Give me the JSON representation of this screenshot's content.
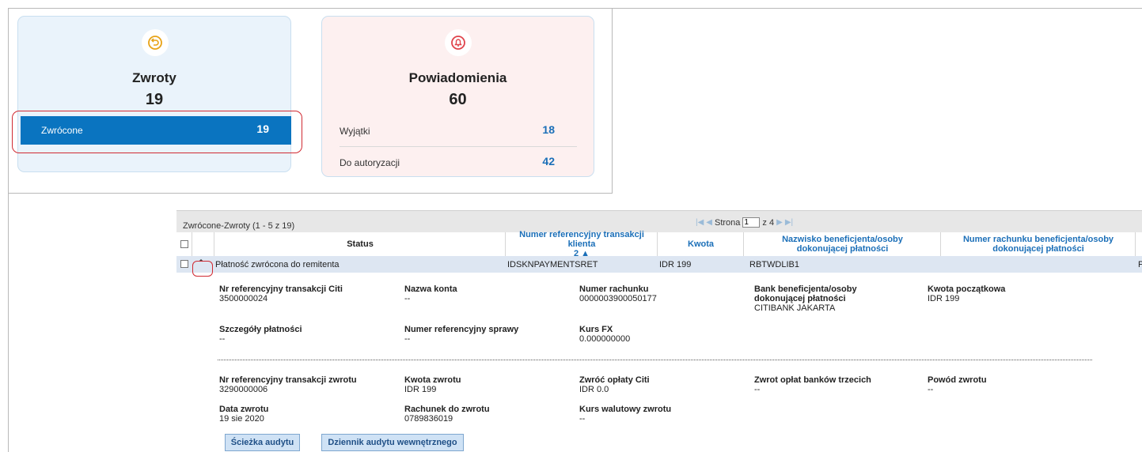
{
  "cards": {
    "zwroty": {
      "title": "Zwroty",
      "count": "19",
      "row_label": "Zwrócone",
      "row_value": "19",
      "color": "#0a74c0"
    },
    "powiadomienia": {
      "title": "Powiadomienia",
      "count": "60",
      "rows": [
        {
          "label": "Wyjątki",
          "value": "18"
        },
        {
          "label": "Do autoryzacji",
          "value": "42"
        }
      ]
    }
  },
  "grid": {
    "title": "Zwrócone-Zwroty (1 - 5 z 19)",
    "pager": {
      "label": "Strona",
      "page": "1",
      "of": "z 4"
    },
    "headers": {
      "status": "Status",
      "ref": "Numer referencyjny transakcji klienta",
      "ref_sort": "2 ▲",
      "amount": "Kwota",
      "beneficiary": "Nazwisko beneficjenta/osoby dokonującej płatności",
      "account": "Numer rachunku beneficjenta/osoby dokonującej płatności"
    },
    "row": {
      "status": "Płatność zwrócona do remitenta",
      "ref": "IDSKNPAYMENTSRET",
      "amount": "IDR 199",
      "beneficiary": "RBTWDLIB1",
      "overflow": "P"
    },
    "details": {
      "citi_ref": {
        "k": "Nr referencyjny transakcji Citi",
        "v": "3500000024"
      },
      "account_name": {
        "k": "Nazwa konta",
        "v": "--"
      },
      "account_no": {
        "k": "Numer rachunku",
        "v": "0000003900050177"
      },
      "bank": {
        "k": "Bank beneficjenta/osoby dokonującej płatności",
        "v": "CITIBANK JAKARTA"
      },
      "initial_amount": {
        "k": "Kwota początkowa",
        "v": "IDR 199"
      },
      "payment_details": {
        "k": "Szczegóły płatności",
        "v": "--"
      },
      "case_ref": {
        "k": "Numer referencyjny sprawy",
        "v": "--"
      },
      "fx": {
        "k": "Kurs FX",
        "v": "0.000000000"
      },
      "return_ref": {
        "k": "Nr referencyjny transakcji zwrotu",
        "v": "3290000006"
      },
      "return_amount": {
        "k": "Kwota zwrotu",
        "v": "IDR 199"
      },
      "citi_fees": {
        "k": "Zwróć opłaty Citi",
        "v": "IDR 0.0"
      },
      "third_fees": {
        "k": "Zwrot opłat banków trzecich",
        "v": "--"
      },
      "reason": {
        "k": "Powód zwrotu",
        "v": "--"
      },
      "return_date": {
        "k": "Data zwrotu",
        "v": "19 sie 2020"
      },
      "return_account": {
        "k": "Rachunek do zwrotu",
        "v": "0789836019"
      },
      "return_fx": {
        "k": "Kurs walutowy zwrotu",
        "v": "--"
      }
    },
    "buttons": {
      "audit": "Ścieżka audytu",
      "internal_audit": "Dziennik audytu wewnętrznego"
    }
  }
}
